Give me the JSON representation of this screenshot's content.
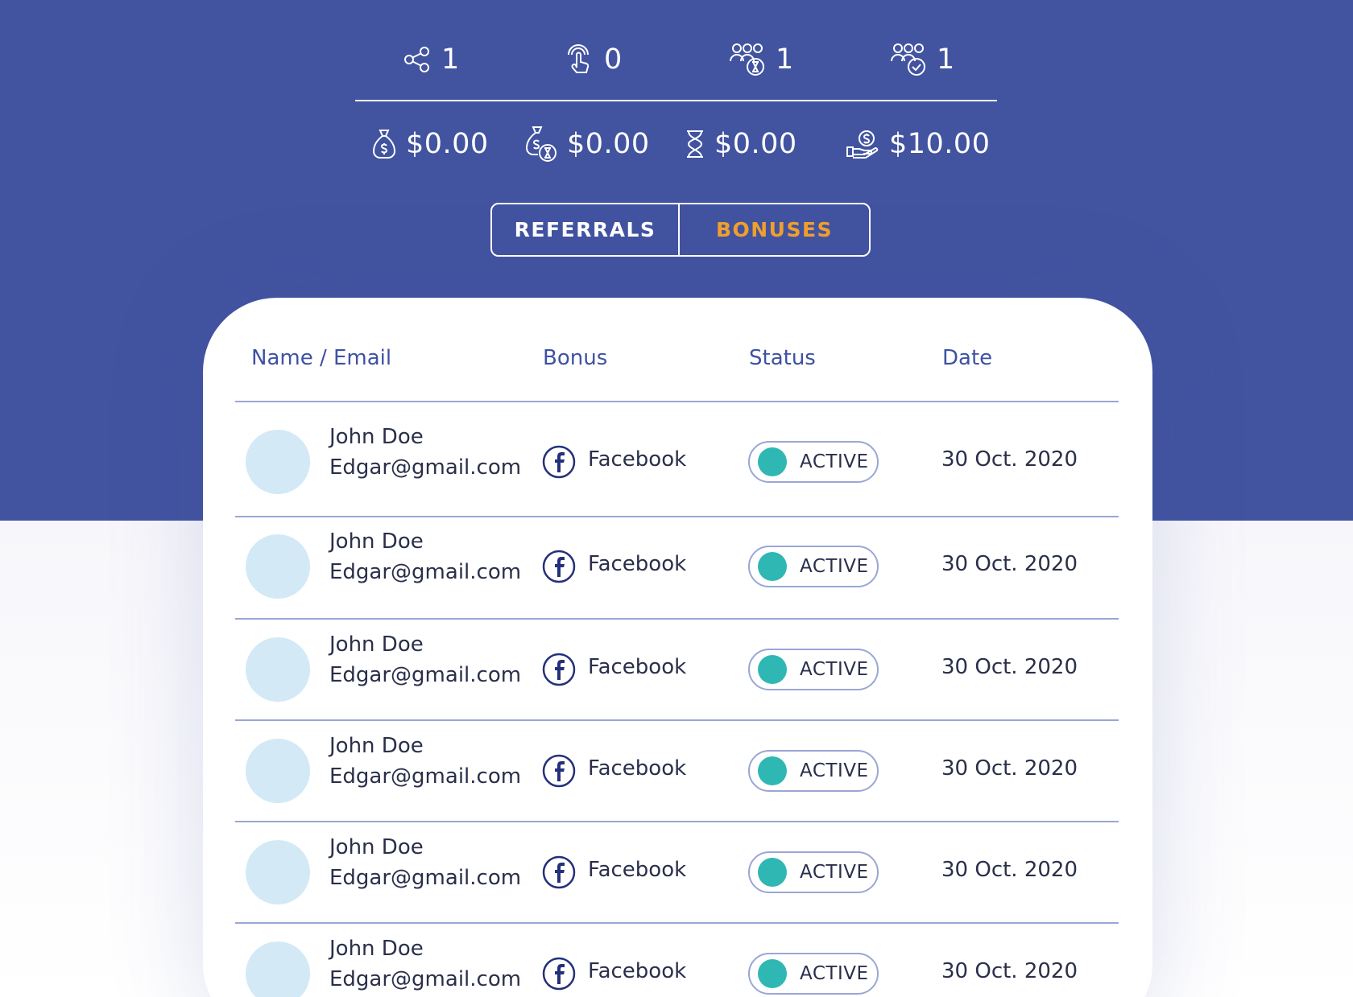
{
  "stats_top": [
    {
      "icon": "share-icon",
      "value": "1"
    },
    {
      "icon": "tap-icon",
      "value": "0"
    },
    {
      "icon": "group-pending-icon",
      "value": "1"
    },
    {
      "icon": "group-approved-icon",
      "value": "1"
    }
  ],
  "stats_bottom": [
    {
      "icon": "money-bag-icon",
      "value": "$0.00"
    },
    {
      "icon": "money-bag-pending-icon",
      "value": "$0.00"
    },
    {
      "icon": "hourglass-icon",
      "value": "$0.00"
    },
    {
      "icon": "hand-money-icon",
      "value": "$10.00"
    }
  ],
  "tabs": {
    "referrals": "REFERRALS",
    "bonuses": "BONUSES",
    "active": "bonuses"
  },
  "colors": {
    "hero": "#4253a0",
    "accent": "#f2a02c",
    "status_dot": "#2fb7b3",
    "avatar": "#d3e9f6"
  },
  "table": {
    "headers": {
      "name": "Name / Email",
      "bonus": "Bonus",
      "status": "Status",
      "date": "Date"
    },
    "rows": [
      {
        "name": "John Doe",
        "email": "Edgar@gmail.com",
        "bonus": "Facebook",
        "status": "ACTIVE",
        "date": "30 Oct. 2020"
      },
      {
        "name": "John Doe",
        "email": "Edgar@gmail.com",
        "bonus": "Facebook",
        "status": "ACTIVE",
        "date": "30 Oct. 2020"
      },
      {
        "name": "John Doe",
        "email": "Edgar@gmail.com",
        "bonus": "Facebook",
        "status": "ACTIVE",
        "date": "30 Oct. 2020"
      },
      {
        "name": "John Doe",
        "email": "Edgar@gmail.com",
        "bonus": "Facebook",
        "status": "ACTIVE",
        "date": "30 Oct. 2020"
      },
      {
        "name": "John Doe",
        "email": "Edgar@gmail.com",
        "bonus": "Facebook",
        "status": "ACTIVE",
        "date": "30 Oct. 2020"
      },
      {
        "name": "John Doe",
        "email": "Edgar@gmail.com",
        "bonus": "Facebook",
        "status": "ACTIVE",
        "date": "30 Oct. 2020"
      }
    ]
  }
}
